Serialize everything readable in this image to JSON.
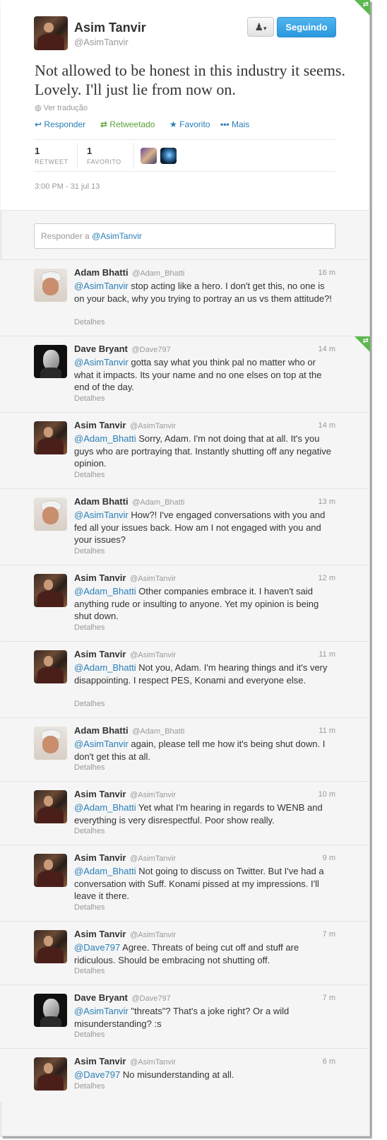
{
  "tweet": {
    "author_name": "Asim Tanvir",
    "author_handle": "@AsimTanvir",
    "text": "Not allowed to be honest in this industry it seems. Lovely. I'll just lie from now on.",
    "translate_label": "Ver tradução",
    "actions": {
      "reply": "Responder",
      "retweeted": "Retweetado",
      "favorite": "Favorito",
      "more": "Mais"
    },
    "stats": {
      "retweets_count": "1",
      "retweets_label": "RETWEET",
      "favorites_count": "1",
      "favorites_label": "FAVORITO"
    },
    "timestamp": "3:00 PM - 31 jul 13",
    "follow_button_label": "Seguindo"
  },
  "reply_box": {
    "placeholder_prefix": "Responder a",
    "placeholder_handle": "@AsimTanvir"
  },
  "replies": [
    {
      "name": "Adam Bhatti",
      "handle": "@Adam_Bhatti",
      "time": "16 m",
      "mention": "@AsimTanvir",
      "text": " stop acting like a hero. I don't get this, no one is on your back, why you trying to portray an us vs them attitude?!",
      "details": "Detalhes"
    },
    {
      "name": "Dave Bryant",
      "handle": "@Dave797",
      "time": "14 m",
      "mention": "@AsimTanvir",
      "text": " gotta say what you think pal no matter who or what it impacts. Its your name and no one elses on top at the end of the day.",
      "details": "Detalhes"
    },
    {
      "name": "Asim Tanvir",
      "handle": "@AsimTanvir",
      "time": "14 m",
      "mention": "@Adam_Bhatti",
      "text": " Sorry, Adam. I'm not doing that at all. It's you guys who are portraying that. Instantly shutting off any negative opinion.",
      "details": "Detalhes"
    },
    {
      "name": "Adam Bhatti",
      "handle": "@Adam_Bhatti",
      "time": "13 m",
      "mention": "@AsimTanvir",
      "text": " How?! I've engaged conversations with you and fed all your issues back. How am I not engaged with you and your issues?",
      "details": "Detalhes"
    },
    {
      "name": "Asim Tanvir",
      "handle": "@AsimTanvir",
      "time": "12 m",
      "mention": "@Adam_Bhatti",
      "text": " Other companies embrace it. I haven't said anything rude or insulting to anyone. Yet my opinion is being shut down.",
      "details": "Detalhes"
    },
    {
      "name": "Asim Tanvir",
      "handle": "@AsimTanvir",
      "time": "11 m",
      "mention": "@Adam_Bhatti",
      "text": " Not you, Adam. I'm hearing things and it's very disappointing. I respect PES, Konami and everyone else.",
      "details": "Detalhes"
    },
    {
      "name": "Adam Bhatti",
      "handle": "@Adam_Bhatti",
      "time": "11 m",
      "mention": "@AsimTanvir",
      "text": " again, please tell me how it's being shut down. I don't get this at all.",
      "details": "Detalhes"
    },
    {
      "name": "Asim Tanvir",
      "handle": "@AsimTanvir",
      "time": "10 m",
      "mention": "@Adam_Bhatti",
      "text": " Yet what I'm hearing in regards to WENB and everything is very disrespectful. Poor show really.",
      "details": "Detalhes"
    },
    {
      "name": "Asim Tanvir",
      "handle": "@AsimTanvir",
      "time": "9 m",
      "mention": "@Adam_Bhatti",
      "text": " Not going to discuss on Twitter. But I've had a conversation with Suff. Konami pissed at my impressions. I'll leave it there.",
      "details": "Detalhes"
    },
    {
      "name": "Asim Tanvir",
      "handle": "@AsimTanvir",
      "time": "7 m",
      "mention": "@Dave797",
      "text": " Agree. Threats of being cut off and stuff are ridiculous. Should be embracing not shutting off.",
      "details": "Detalhes"
    },
    {
      "name": "Dave Bryant",
      "handle": "@Dave797",
      "time": "7 m",
      "mention": "@AsimTanvir",
      "text": " \"threats\"? That's a joke right? Or a wild misunderstanding? :s",
      "details": "Detalhes"
    },
    {
      "name": "Asim Tanvir",
      "handle": "@AsimTanvir",
      "time": "6 m",
      "mention": "@Dave797",
      "text": " No misunderstanding at all.",
      "details": "Detalhes"
    }
  ],
  "colors": {
    "link": "#2a7fb8",
    "retweeted_green": "#5aa13a",
    "follow_button": "#2c97de",
    "corner_badge": "#5cb84f"
  }
}
